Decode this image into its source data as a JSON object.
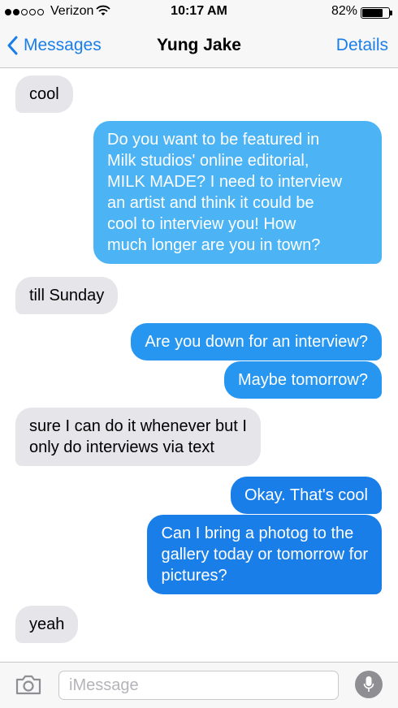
{
  "status_bar": {
    "carrier": "Verizon",
    "signal_bars_filled": 2,
    "signal_bars_total": 5,
    "time": "10:17 AM",
    "battery_percent": "82%",
    "battery_level": 0.82
  },
  "nav": {
    "back_label": "Messages",
    "title": "Yung  Jake",
    "details_label": "Details"
  },
  "messages": [
    {
      "direction": "incoming",
      "text": "cool"
    },
    {
      "direction": "outgoing",
      "text": "Do you want to be featured in\nMilk studios' online editorial,\nMILK MADE? I need to interview\nan artist and think it could be\ncool to interview you! How\nmuch longer are you in town?"
    },
    {
      "direction": "incoming",
      "text": "till Sunday"
    },
    {
      "direction": "outgoing",
      "text": "Are you down for an interview?"
    },
    {
      "direction": "outgoing",
      "text": "Maybe tomorrow?"
    },
    {
      "direction": "incoming",
      "text": "sure I can do it whenever but I\nonly do interviews via text"
    },
    {
      "direction": "outgoing",
      "text": "Okay. That's cool"
    },
    {
      "direction": "outgoing",
      "text": "Can I bring a photog to the\ngallery today or tomorrow for\npictures?"
    },
    {
      "direction": "incoming",
      "text": "yeah"
    }
  ],
  "input": {
    "placeholder": "iMessage",
    "value": ""
  },
  "icons": {
    "back": "chevron-left-icon",
    "wifi": "wifi-icon",
    "battery": "battery-icon",
    "camera": "camera-icon",
    "microphone": "microphone-icon"
  },
  "colors": {
    "accent": "#1a7ee8",
    "incoming_bubble": "#e5e5ea",
    "outgoing_bubble_top": "#4cb4f5",
    "outgoing_bubble_bottom": "#1a7ee8",
    "bar_background": "#f7f7f8"
  }
}
